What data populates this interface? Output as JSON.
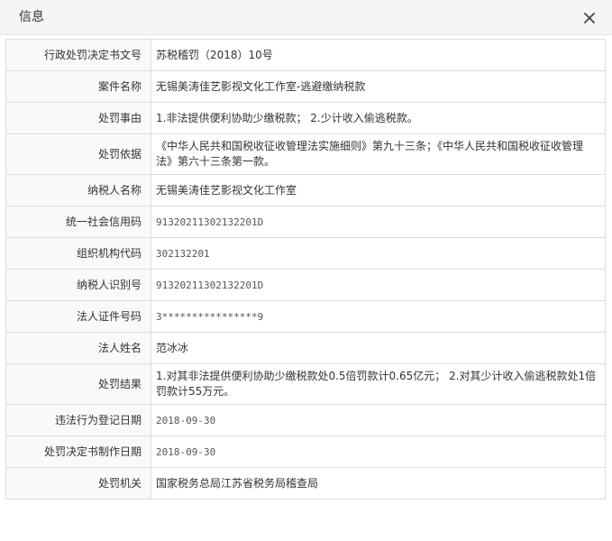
{
  "dialog": {
    "title": "信息",
    "close_icon": "close-icon"
  },
  "rows": [
    {
      "label": "行政处罚决定书文号",
      "value": "苏税稽罚（2018）10号"
    },
    {
      "label": "案件名称",
      "value": "无锡美涛佳艺影视文化工作室-逃避缴纳税款"
    },
    {
      "label": "处罚事由",
      "value": "1.非法提供便利协助少缴税款；  2.少计收入偷逃税款。"
    },
    {
      "label": "处罚依据",
      "value": "《中华人民共和国税收征收管理法实施细则》第九十三条；《中华人民共和国税收征收管理法》第六十三条第一款。"
    },
    {
      "label": "纳税人名称",
      "value": "无锡美涛佳艺影视文化工作室"
    },
    {
      "label": "统一社会信用码",
      "value": "91320211302132201D"
    },
    {
      "label": "组织机构代码",
      "value": "302132201"
    },
    {
      "label": "纳税人识别号",
      "value": "91320211302132201D"
    },
    {
      "label": "法人证件号码",
      "value": "3****************9"
    },
    {
      "label": "法人姓名",
      "value": "范冰冰"
    },
    {
      "label": "处罚结果",
      "value": "1.对其非法提供便利协助少缴税款处0.5倍罚款计0.65亿元；  2.对其少计收入偷逃税款处1倍罚款计55万元。"
    },
    {
      "label": "违法行为登记日期",
      "value": "2018-09-30"
    },
    {
      "label": "处罚决定书制作日期",
      "value": "2018-09-30"
    },
    {
      "label": "处罚机关",
      "value": "国家税务总局江苏省税务局稽查局"
    }
  ]
}
